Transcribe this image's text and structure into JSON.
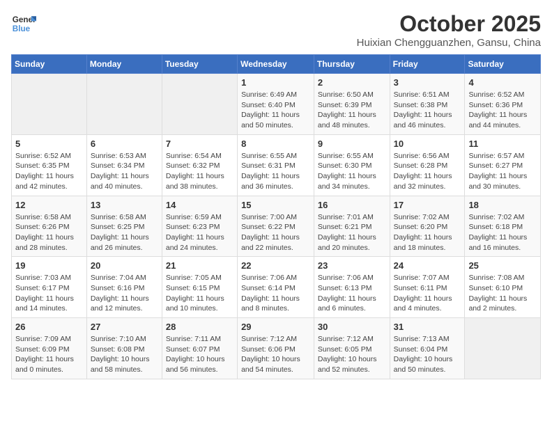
{
  "logo": {
    "line1": "General",
    "line2": "Blue"
  },
  "title": "October 2025",
  "location": "Huixian Chengguanzhen, Gansu, China",
  "weekdays": [
    "Sunday",
    "Monday",
    "Tuesday",
    "Wednesday",
    "Thursday",
    "Friday",
    "Saturday"
  ],
  "weeks": [
    [
      {
        "day": "",
        "info": ""
      },
      {
        "day": "",
        "info": ""
      },
      {
        "day": "",
        "info": ""
      },
      {
        "day": "1",
        "info": "Sunrise: 6:49 AM\nSunset: 6:40 PM\nDaylight: 11 hours\nand 50 minutes."
      },
      {
        "day": "2",
        "info": "Sunrise: 6:50 AM\nSunset: 6:39 PM\nDaylight: 11 hours\nand 48 minutes."
      },
      {
        "day": "3",
        "info": "Sunrise: 6:51 AM\nSunset: 6:38 PM\nDaylight: 11 hours\nand 46 minutes."
      },
      {
        "day": "4",
        "info": "Sunrise: 6:52 AM\nSunset: 6:36 PM\nDaylight: 11 hours\nand 44 minutes."
      }
    ],
    [
      {
        "day": "5",
        "info": "Sunrise: 6:52 AM\nSunset: 6:35 PM\nDaylight: 11 hours\nand 42 minutes."
      },
      {
        "day": "6",
        "info": "Sunrise: 6:53 AM\nSunset: 6:34 PM\nDaylight: 11 hours\nand 40 minutes."
      },
      {
        "day": "7",
        "info": "Sunrise: 6:54 AM\nSunset: 6:32 PM\nDaylight: 11 hours\nand 38 minutes."
      },
      {
        "day": "8",
        "info": "Sunrise: 6:55 AM\nSunset: 6:31 PM\nDaylight: 11 hours\nand 36 minutes."
      },
      {
        "day": "9",
        "info": "Sunrise: 6:55 AM\nSunset: 6:30 PM\nDaylight: 11 hours\nand 34 minutes."
      },
      {
        "day": "10",
        "info": "Sunrise: 6:56 AM\nSunset: 6:28 PM\nDaylight: 11 hours\nand 32 minutes."
      },
      {
        "day": "11",
        "info": "Sunrise: 6:57 AM\nSunset: 6:27 PM\nDaylight: 11 hours\nand 30 minutes."
      }
    ],
    [
      {
        "day": "12",
        "info": "Sunrise: 6:58 AM\nSunset: 6:26 PM\nDaylight: 11 hours\nand 28 minutes."
      },
      {
        "day": "13",
        "info": "Sunrise: 6:58 AM\nSunset: 6:25 PM\nDaylight: 11 hours\nand 26 minutes."
      },
      {
        "day": "14",
        "info": "Sunrise: 6:59 AM\nSunset: 6:23 PM\nDaylight: 11 hours\nand 24 minutes."
      },
      {
        "day": "15",
        "info": "Sunrise: 7:00 AM\nSunset: 6:22 PM\nDaylight: 11 hours\nand 22 minutes."
      },
      {
        "day": "16",
        "info": "Sunrise: 7:01 AM\nSunset: 6:21 PM\nDaylight: 11 hours\nand 20 minutes."
      },
      {
        "day": "17",
        "info": "Sunrise: 7:02 AM\nSunset: 6:20 PM\nDaylight: 11 hours\nand 18 minutes."
      },
      {
        "day": "18",
        "info": "Sunrise: 7:02 AM\nSunset: 6:18 PM\nDaylight: 11 hours\nand 16 minutes."
      }
    ],
    [
      {
        "day": "19",
        "info": "Sunrise: 7:03 AM\nSunset: 6:17 PM\nDaylight: 11 hours\nand 14 minutes."
      },
      {
        "day": "20",
        "info": "Sunrise: 7:04 AM\nSunset: 6:16 PM\nDaylight: 11 hours\nand 12 minutes."
      },
      {
        "day": "21",
        "info": "Sunrise: 7:05 AM\nSunset: 6:15 PM\nDaylight: 11 hours\nand 10 minutes."
      },
      {
        "day": "22",
        "info": "Sunrise: 7:06 AM\nSunset: 6:14 PM\nDaylight: 11 hours\nand 8 minutes."
      },
      {
        "day": "23",
        "info": "Sunrise: 7:06 AM\nSunset: 6:13 PM\nDaylight: 11 hours\nand 6 minutes."
      },
      {
        "day": "24",
        "info": "Sunrise: 7:07 AM\nSunset: 6:11 PM\nDaylight: 11 hours\nand 4 minutes."
      },
      {
        "day": "25",
        "info": "Sunrise: 7:08 AM\nSunset: 6:10 PM\nDaylight: 11 hours\nand 2 minutes."
      }
    ],
    [
      {
        "day": "26",
        "info": "Sunrise: 7:09 AM\nSunset: 6:09 PM\nDaylight: 11 hours\nand 0 minutes."
      },
      {
        "day": "27",
        "info": "Sunrise: 7:10 AM\nSunset: 6:08 PM\nDaylight: 10 hours\nand 58 minutes."
      },
      {
        "day": "28",
        "info": "Sunrise: 7:11 AM\nSunset: 6:07 PM\nDaylight: 10 hours\nand 56 minutes."
      },
      {
        "day": "29",
        "info": "Sunrise: 7:12 AM\nSunset: 6:06 PM\nDaylight: 10 hours\nand 54 minutes."
      },
      {
        "day": "30",
        "info": "Sunrise: 7:12 AM\nSunset: 6:05 PM\nDaylight: 10 hours\nand 52 minutes."
      },
      {
        "day": "31",
        "info": "Sunrise: 7:13 AM\nSunset: 6:04 PM\nDaylight: 10 hours\nand 50 minutes."
      },
      {
        "day": "",
        "info": ""
      }
    ]
  ]
}
